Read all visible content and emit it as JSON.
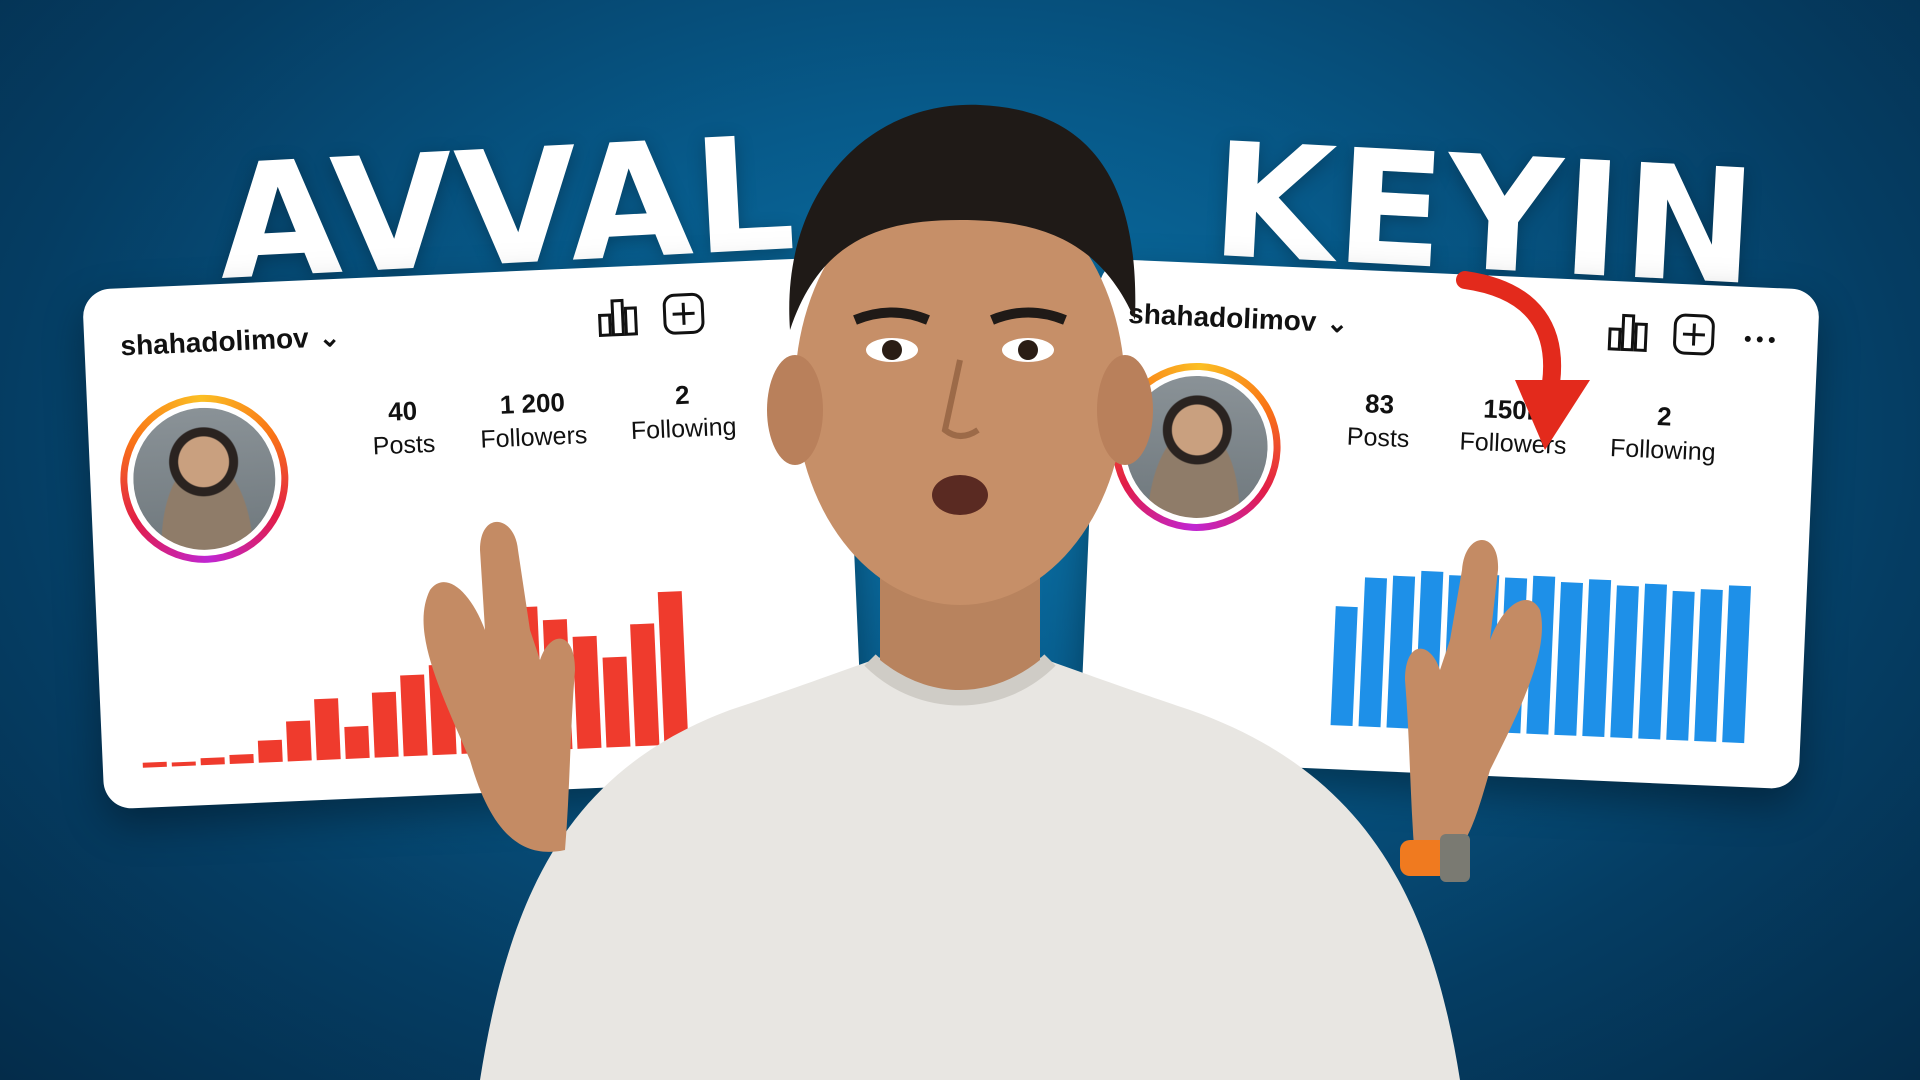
{
  "headlines": {
    "before": "AVVAL",
    "after": "KEYIN"
  },
  "before_card": {
    "username": "shahadolimov",
    "stats": [
      {
        "value": "40",
        "label": "Posts"
      },
      {
        "value": "1 200",
        "label": "Followers"
      },
      {
        "value": "2",
        "label": "Following"
      }
    ],
    "bar_color": "#ef3b2d",
    "bar_levels": [
      0.03,
      0.02,
      0.04,
      0.05,
      0.12,
      0.22,
      0.34,
      0.18,
      0.36,
      0.45,
      0.5,
      0.74,
      0.62,
      0.8,
      0.72,
      0.62,
      0.5,
      0.68,
      0.85
    ]
  },
  "after_card": {
    "username": "shahadolimov",
    "stats": [
      {
        "value": "83",
        "label": "Posts"
      },
      {
        "value": "150K",
        "label": "Followers"
      },
      {
        "value": "2",
        "label": "Following"
      }
    ],
    "bar_color": "#1e90e8",
    "bar_levels": [
      0.72,
      0.9,
      0.92,
      0.96,
      0.94,
      0.95,
      0.94,
      0.96,
      0.93,
      0.95,
      0.92,
      0.94,
      0.9,
      0.92,
      0.95
    ]
  },
  "arrow_color": "#e32a1c",
  "icons": [
    "chart-icon",
    "add-post-icon",
    "more-icon",
    "chevron-down-icon"
  ]
}
